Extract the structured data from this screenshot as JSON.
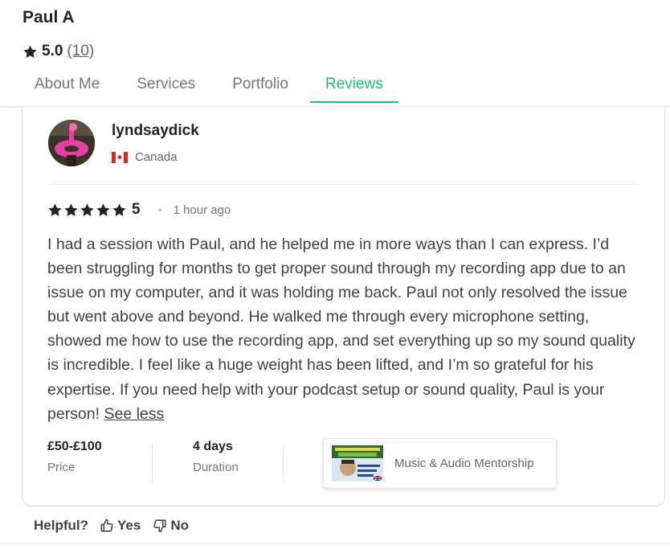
{
  "seller": {
    "name": "Paul A",
    "rating": "5.0",
    "review_count": "(10)"
  },
  "tabs": [
    {
      "label": "About Me",
      "active": false
    },
    {
      "label": "Services",
      "active": false
    },
    {
      "label": "Portfolio",
      "active": false
    },
    {
      "label": "Reviews",
      "active": true
    }
  ],
  "review": {
    "reviewer_name": "lyndsaydick",
    "country": "Canada",
    "stars": 5,
    "score": "5",
    "time": "1 hour ago",
    "text": "I had a session with Paul, and he helped me in more ways than I can express. I’d been struggling for months to get proper sound through my recording app due to an issue on my computer, and it was holding me back. Paul not only resolved the issue but went above and beyond. He walked me through every microphone setting, showed me how to use the recording app, and set everything up so my sound quality is incredible. I feel like a huge weight has been lifted, and I’m so grateful for his expertise. If you need help with your podcast setup or sound quality, Paul is your person!",
    "see_less": "See less",
    "price_value": "£50-£100",
    "price_label": "Price",
    "duration_value": "4 days",
    "duration_label": "Duration",
    "gig_title": "Music & Audio Mentorship"
  },
  "helpful": {
    "question": "Helpful?",
    "yes": "Yes",
    "no": "No"
  },
  "colors": {
    "accent": "#1dbf73",
    "text": "#222325",
    "muted": "#74767e"
  },
  "icons": [
    "star-icon",
    "canada-flag-icon",
    "thumbs-up-icon",
    "thumbs-down-icon"
  ]
}
